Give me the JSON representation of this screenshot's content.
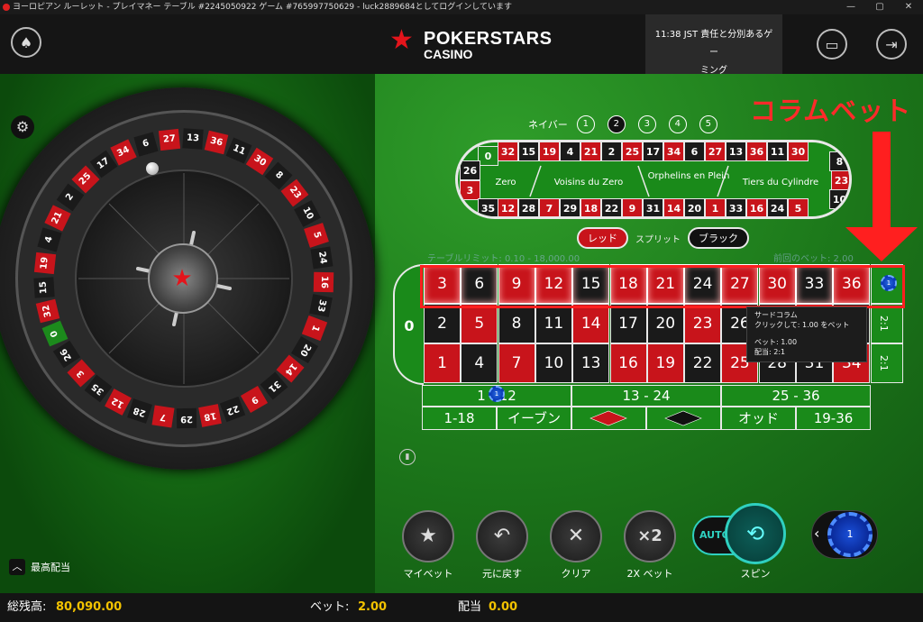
{
  "window": {
    "title": "ヨーロピアン ルーレット - プレイマネー テーブル #2245050922 ゲーム #765997750629 - luck2889684としてログインしています",
    "buttons": [
      "—",
      "▢",
      "✕"
    ]
  },
  "header": {
    "brand_line1": "POKERSTARS",
    "brand_line2": "CASINO",
    "clock_line1": "11:38 JST 責任と分別あるゲー",
    "clock_line2": "ミング"
  },
  "annotation": {
    "text": "コラムベット",
    "color": "#ff1f1f"
  },
  "neighbors": {
    "label": "ネイバー",
    "options": [
      "1",
      "2",
      "3",
      "4",
      "5"
    ],
    "selected": "2"
  },
  "racetrack": {
    "top_row": [
      {
        "n": "32",
        "c": "r"
      },
      {
        "n": "15",
        "c": "b"
      },
      {
        "n": "19",
        "c": "r"
      },
      {
        "n": "4",
        "c": "b"
      },
      {
        "n": "21",
        "c": "r"
      },
      {
        "n": "2",
        "c": "b"
      },
      {
        "n": "25",
        "c": "r"
      },
      {
        "n": "17",
        "c": "b"
      },
      {
        "n": "34",
        "c": "r"
      },
      {
        "n": "6",
        "c": "b"
      },
      {
        "n": "27",
        "c": "r"
      },
      {
        "n": "13",
        "c": "b"
      },
      {
        "n": "36",
        "c": "r"
      },
      {
        "n": "11",
        "c": "b"
      },
      {
        "n": "30",
        "c": "r"
      }
    ],
    "bottom_row": [
      {
        "n": "12",
        "c": "r"
      },
      {
        "n": "28",
        "c": "b"
      },
      {
        "n": "7",
        "c": "r"
      },
      {
        "n": "29",
        "c": "b"
      },
      {
        "n": "18",
        "c": "r"
      },
      {
        "n": "22",
        "c": "b"
      },
      {
        "n": "9",
        "c": "r"
      },
      {
        "n": "31",
        "c": "b"
      },
      {
        "n": "14",
        "c": "r"
      },
      {
        "n": "20",
        "c": "b"
      },
      {
        "n": "1",
        "c": "r"
      },
      {
        "n": "33",
        "c": "b"
      },
      {
        "n": "16",
        "c": "r"
      },
      {
        "n": "24",
        "c": "b"
      },
      {
        "n": "5",
        "c": "r"
      }
    ],
    "left_end": [
      {
        "n": "0",
        "c": "g"
      },
      {
        "n": "26",
        "c": "b"
      },
      {
        "n": "3",
        "c": "r"
      },
      {
        "n": "35",
        "c": "b"
      }
    ],
    "right_end": [
      {
        "n": "8",
        "c": "b"
      },
      {
        "n": "23",
        "c": "r"
      },
      {
        "n": "10",
        "c": "b"
      }
    ],
    "zones": [
      "Zero",
      "Voisins du Zero",
      "Orphelins en Plein",
      "Tiers du Cylindre"
    ]
  },
  "redblack": {
    "red": "レッド",
    "split": "スプリット",
    "black": "ブラック"
  },
  "limits": {
    "table_limit": "テーブルリミット: 0.10 - 18,000.00",
    "last_bet": "前回のベット: 2.00"
  },
  "board": {
    "zero": "0",
    "rows": [
      [
        {
          "n": "3",
          "c": "r"
        },
        {
          "n": "6",
          "c": "b"
        },
        {
          "n": "9",
          "c": "r"
        },
        {
          "n": "12",
          "c": "r"
        },
        {
          "n": "15",
          "c": "b"
        },
        {
          "n": "18",
          "c": "r"
        },
        {
          "n": "21",
          "c": "r"
        },
        {
          "n": "24",
          "c": "b"
        },
        {
          "n": "27",
          "c": "r"
        },
        {
          "n": "30",
          "c": "r"
        },
        {
          "n": "33",
          "c": "b"
        },
        {
          "n": "36",
          "c": "r"
        }
      ],
      [
        {
          "n": "2",
          "c": "b"
        },
        {
          "n": "5",
          "c": "r"
        },
        {
          "n": "8",
          "c": "b"
        },
        {
          "n": "11",
          "c": "b"
        },
        {
          "n": "14",
          "c": "r"
        },
        {
          "n": "17",
          "c": "b"
        },
        {
          "n": "20",
          "c": "b"
        },
        {
          "n": "23",
          "c": "r"
        },
        {
          "n": "26",
          "c": "b"
        },
        {
          "n": "29",
          "c": "b"
        },
        {
          "n": "32",
          "c": "r"
        },
        {
          "n": "35",
          "c": "b"
        }
      ],
      [
        {
          "n": "1",
          "c": "r"
        },
        {
          "n": "4",
          "c": "b"
        },
        {
          "n": "7",
          "c": "r"
        },
        {
          "n": "10",
          "c": "b"
        },
        {
          "n": "13",
          "c": "b"
        },
        {
          "n": "16",
          "c": "r"
        },
        {
          "n": "19",
          "c": "r"
        },
        {
          "n": "22",
          "c": "b"
        },
        {
          "n": "25",
          "c": "r"
        },
        {
          "n": "28",
          "c": "b"
        },
        {
          "n": "31",
          "c": "b"
        },
        {
          "n": "34",
          "c": "r"
        }
      ]
    ],
    "col_labels": [
      "2:1",
      "2:1"
    ],
    "dozens": [
      "1 - 12",
      "13 - 24",
      "25 - 36"
    ],
    "outside": [
      "1-18",
      "イーブン",
      "",
      "",
      "オッド",
      "19-36"
    ],
    "red_color": "#c8141b",
    "black_color": "#1a1a1a"
  },
  "tooltip": {
    "title": "サードコラム",
    "line1": "クリックして: 1.00 をベット",
    "line2": "ベット: 1.00",
    "line3": "配当: 2:1"
  },
  "chips_on_table": [
    "1",
    "1"
  ],
  "wheel": {
    "numbers": [
      {
        "n": "0",
        "c": "g"
      },
      {
        "n": "32",
        "c": "r"
      },
      {
        "n": "15",
        "c": "b"
      },
      {
        "n": "19",
        "c": "r"
      },
      {
        "n": "4",
        "c": "b"
      },
      {
        "n": "21",
        "c": "r"
      },
      {
        "n": "2",
        "c": "b"
      },
      {
        "n": "25",
        "c": "r"
      },
      {
        "n": "17",
        "c": "b"
      },
      {
        "n": "34",
        "c": "r"
      },
      {
        "n": "6",
        "c": "b"
      },
      {
        "n": "27",
        "c": "r"
      },
      {
        "n": "13",
        "c": "b"
      },
      {
        "n": "36",
        "c": "r"
      },
      {
        "n": "11",
        "c": "b"
      },
      {
        "n": "30",
        "c": "r"
      },
      {
        "n": "8",
        "c": "b"
      },
      {
        "n": "23",
        "c": "r"
      },
      {
        "n": "10",
        "c": "b"
      },
      {
        "n": "5",
        "c": "r"
      },
      {
        "n": "24",
        "c": "b"
      },
      {
        "n": "16",
        "c": "r"
      },
      {
        "n": "33",
        "c": "b"
      },
      {
        "n": "1",
        "c": "r"
      },
      {
        "n": "20",
        "c": "b"
      },
      {
        "n": "14",
        "c": "r"
      },
      {
        "n": "31",
        "c": "b"
      },
      {
        "n": "9",
        "c": "r"
      },
      {
        "n": "22",
        "c": "b"
      },
      {
        "n": "18",
        "c": "r"
      },
      {
        "n": "29",
        "c": "b"
      },
      {
        "n": "7",
        "c": "r"
      },
      {
        "n": "28",
        "c": "b"
      },
      {
        "n": "12",
        "c": "r"
      },
      {
        "n": "35",
        "c": "b"
      },
      {
        "n": "3",
        "c": "r"
      },
      {
        "n": "26",
        "c": "b"
      }
    ]
  },
  "max_payout_label": "最高配当",
  "controls": {
    "my_bet": "マイベット",
    "undo": "元に戻す",
    "clear": "クリア",
    "double": "2X ベット",
    "double_icon": "×2",
    "auto": "AUTO",
    "spin": "スピン",
    "chip_value": "1"
  },
  "footer": {
    "balance_label": "総残高:",
    "balance_value": "80,090.00",
    "bet_label": "ベット:",
    "bet_value": "2.00",
    "payout_label": "配当",
    "payout_value": "0.00"
  }
}
